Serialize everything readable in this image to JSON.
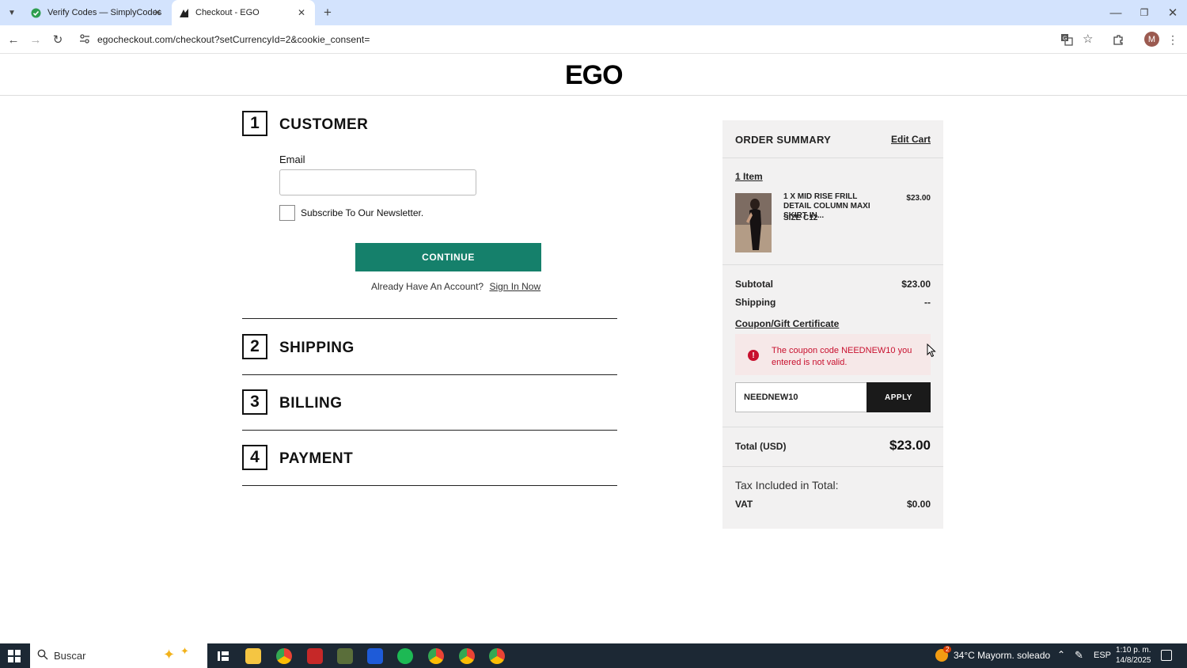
{
  "browser": {
    "tabs": [
      {
        "title": "Verify Codes — SimplyCodes",
        "active": false
      },
      {
        "title": "Checkout - EGO",
        "active": true
      }
    ],
    "url": "egocheckout.com/checkout?setCurrencyId=2&cookie_consent=",
    "profile_initial": "M"
  },
  "site": {
    "logo": "EGO"
  },
  "steps": [
    {
      "number": "1",
      "title": "CUSTOMER"
    },
    {
      "number": "2",
      "title": "SHIPPING"
    },
    {
      "number": "3",
      "title": "BILLING"
    },
    {
      "number": "4",
      "title": "PAYMENT"
    }
  ],
  "customer": {
    "email_label": "Email",
    "email_value": "",
    "newsletter_label": "Subscribe To Our Newsletter.",
    "continue_label": "CONTINUE",
    "account_prompt": "Already Have An Account?",
    "signin_label": "Sign In Now"
  },
  "summary": {
    "title": "ORDER SUMMARY",
    "edit_cart": "Edit Cart",
    "item_count": "1 Item",
    "product": {
      "name": "1 X MID RISE FRILL DETAIL COLUMN MAXI SKIRT IN...",
      "size": "SIZE C12",
      "price": "$23.00"
    },
    "subtotal_label": "Subtotal",
    "subtotal_value": "$23.00",
    "shipping_label": "Shipping",
    "shipping_value": "--",
    "coupon_link": "Coupon/Gift Certificate",
    "coupon_error": "The coupon code NEEDNEW10 you entered is not valid.",
    "coupon_value": "NEEDNEW10",
    "apply_label": "APPLY",
    "total_label": "Total (USD)",
    "total_value": "$23.00",
    "tax_label": "Tax Included in Total:",
    "vat_label": "VAT",
    "vat_value": "$0.00"
  },
  "colors": {
    "continue_button": "#15806b",
    "error_text": "#c8102e",
    "error_bg": "#f6e8e8",
    "summary_bg": "#f2f1f1"
  },
  "taskbar": {
    "search_placeholder": "Buscar",
    "weather": "34°C Mayorm. soleado",
    "weather_badge": "2",
    "language": "ESP",
    "time": "1:10 p. m.",
    "date": "14/8/2025"
  }
}
